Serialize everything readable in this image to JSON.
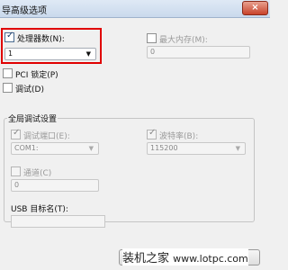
{
  "window": {
    "title": "导高级选项",
    "close_glyph": "×"
  },
  "processor": {
    "label": "处理器数(N):",
    "value": "1",
    "checked": true
  },
  "max_memory": {
    "label": "最大内存(M):",
    "value": "0",
    "checked": false
  },
  "pci_lock": {
    "label": "PCI 锁定(P)",
    "checked": false
  },
  "debug": {
    "label": "调试(D)",
    "checked": false
  },
  "global_debug": {
    "title": "全局调试设置",
    "debug_port": {
      "label": "调试端口(E):",
      "value": "COM1:",
      "checked": true
    },
    "baud_rate": {
      "label": "波特率(B):",
      "value": "115200",
      "checked": true
    },
    "channel": {
      "label": "通道(C)",
      "value": "0",
      "checked": false
    },
    "usb_target": {
      "label": "USB 目标名(T):",
      "value": ""
    }
  },
  "watermark": {
    "text": "装机之家",
    "url": "www.lotpc.com"
  }
}
